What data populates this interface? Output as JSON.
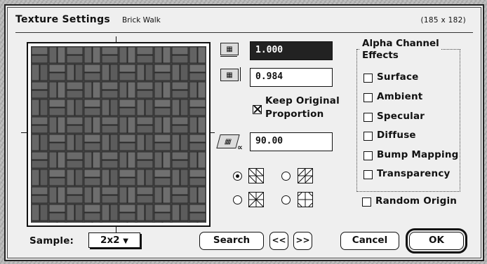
{
  "window": {
    "title": "Texture Settings",
    "texture_name": "Brick Walk",
    "dimensions": "(185 x 182)"
  },
  "preview": {
    "icon": "brick-texture-preview"
  },
  "fields": {
    "horizontal_scale": {
      "value": "1.000",
      "icon": "horizontal-scale-icon"
    },
    "vertical_scale": {
      "value": "0.984",
      "icon": "vertical-scale-icon"
    },
    "angle": {
      "value": "90.00",
      "icon": "rotation-angle-icon"
    }
  },
  "keep_proportion": {
    "label_line1": "Keep Original",
    "label_line2": "Proportion",
    "checked": true
  },
  "patterns": [
    {
      "selected": true,
      "icon": "tile-pattern-1-icon"
    },
    {
      "selected": false,
      "icon": "tile-pattern-2-icon"
    },
    {
      "selected": false,
      "icon": "tile-pattern-3-icon"
    },
    {
      "selected": false,
      "icon": "tile-pattern-4-icon"
    }
  ],
  "alpha_group": {
    "title_line1": "Alpha Channel",
    "title_line2": "Effects",
    "items": [
      {
        "label": "Surface",
        "checked": false
      },
      {
        "label": "Ambient",
        "checked": false
      },
      {
        "label": "Specular",
        "checked": false
      },
      {
        "label": "Diffuse",
        "checked": false
      },
      {
        "label": "Bump Mapping",
        "checked": false
      },
      {
        "label": "Transparency",
        "checked": false
      }
    ]
  },
  "random_origin": {
    "label": "Random Origin",
    "checked": false
  },
  "sample": {
    "label": "Sample:",
    "value": "2x2"
  },
  "buttons": {
    "search": "Search",
    "prev": "<<",
    "next": ">>",
    "cancel": "Cancel",
    "ok": "OK"
  }
}
